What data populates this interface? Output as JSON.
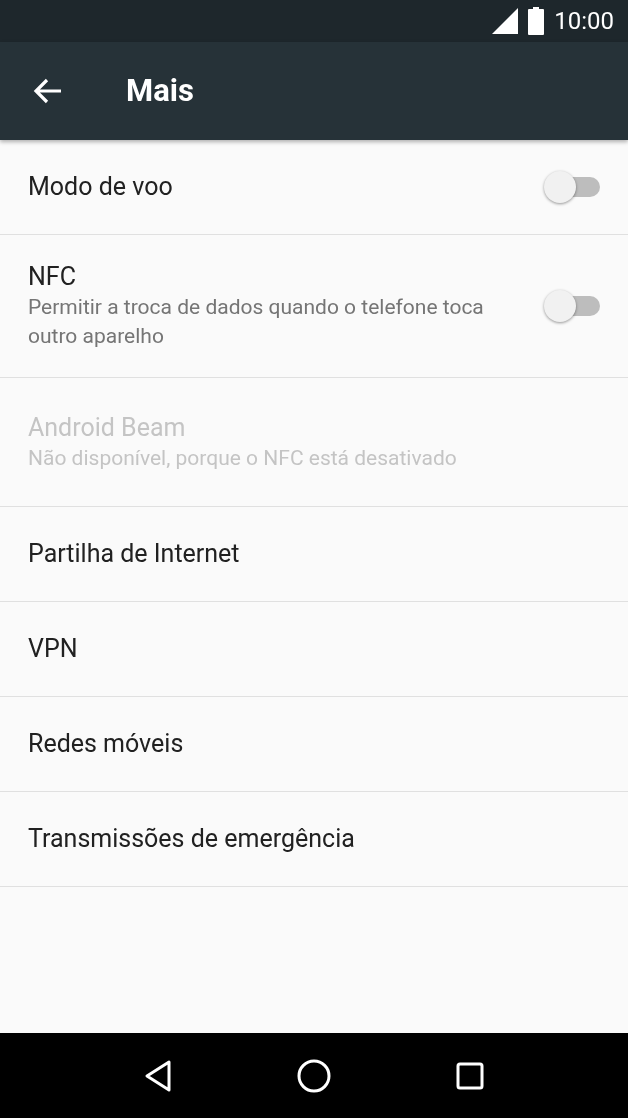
{
  "status_bar": {
    "time": "10:00"
  },
  "toolbar": {
    "title": "Mais"
  },
  "items": [
    {
      "kind": "switch",
      "title": "Modo de voo",
      "on": false,
      "disabled": false
    },
    {
      "kind": "switch",
      "title": "NFC",
      "subtitle": "Permitir a troca de dados quando o telefone toca outro aparelho",
      "on": false,
      "disabled": false
    },
    {
      "kind": "plain",
      "title": "Android Beam",
      "subtitle": "Não disponível, porque o NFC está desativado",
      "disabled": true
    },
    {
      "kind": "plain",
      "title": "Partilha de Internet",
      "disabled": false
    },
    {
      "kind": "plain",
      "title": "VPN",
      "disabled": false
    },
    {
      "kind": "plain",
      "title": "Redes móveis",
      "disabled": false
    },
    {
      "kind": "plain",
      "title": "Transmissões de emergência",
      "disabled": false
    }
  ]
}
